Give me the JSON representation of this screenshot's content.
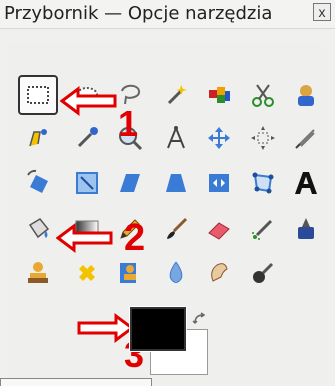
{
  "window": {
    "title": "Przybornik — Opcje narzędzia",
    "close_label": "x"
  },
  "tools": [
    {
      "name": "rect-select",
      "icon": "rectangle-select-icon",
      "selected": true
    },
    {
      "name": "ellipse-select",
      "icon": "ellipse-select-icon"
    },
    {
      "name": "free-select",
      "icon": "lasso-icon"
    },
    {
      "name": "fuzzy-select",
      "icon": "magic-wand-icon"
    },
    {
      "name": "color-select",
      "icon": "color-select-icon"
    },
    {
      "name": "scissors-select",
      "icon": "scissors-icon"
    },
    {
      "name": "foreground-select",
      "icon": "foreground-select-icon"
    },
    {
      "name": "paths",
      "icon": "paths-icon"
    },
    {
      "name": "color-picker",
      "icon": "color-picker-icon"
    },
    {
      "name": "zoom",
      "icon": "zoom-icon"
    },
    {
      "name": "measure",
      "icon": "measure-icon"
    },
    {
      "name": "move",
      "icon": "move-icon"
    },
    {
      "name": "align",
      "icon": "align-icon"
    },
    {
      "name": "crop",
      "icon": "crop-icon"
    },
    {
      "name": "rotate",
      "icon": "rotate-icon"
    },
    {
      "name": "scale",
      "icon": "scale-icon"
    },
    {
      "name": "shear",
      "icon": "shear-icon"
    },
    {
      "name": "perspective",
      "icon": "perspective-icon"
    },
    {
      "name": "flip",
      "icon": "flip-icon"
    },
    {
      "name": "cage",
      "icon": "cage-transform-icon"
    },
    {
      "name": "text",
      "icon": "text-icon"
    },
    {
      "name": "bucket-fill",
      "icon": "bucket-fill-icon"
    },
    {
      "name": "blend",
      "icon": "gradient-icon"
    },
    {
      "name": "pencil",
      "icon": "pencil-icon"
    },
    {
      "name": "paintbrush",
      "icon": "paintbrush-icon"
    },
    {
      "name": "eraser",
      "icon": "eraser-icon"
    },
    {
      "name": "airbrush",
      "icon": "airbrush-icon"
    },
    {
      "name": "ink",
      "icon": "ink-icon"
    },
    {
      "name": "clone",
      "icon": "clone-stamp-icon"
    },
    {
      "name": "heal",
      "icon": "heal-icon"
    },
    {
      "name": "perspective-clone",
      "icon": "perspective-clone-icon"
    },
    {
      "name": "blur-sharpen",
      "icon": "blur-drop-icon"
    },
    {
      "name": "smudge",
      "icon": "smudge-icon"
    },
    {
      "name": "dodge-burn",
      "icon": "dodge-burn-icon"
    }
  ],
  "annotations": [
    {
      "label": "1",
      "color": "#e00000"
    },
    {
      "label": "2",
      "color": "#e00000"
    },
    {
      "label": "3",
      "color": "#e00000"
    }
  ],
  "colors": {
    "foreground": "#000000",
    "background": "#ffffff"
  }
}
